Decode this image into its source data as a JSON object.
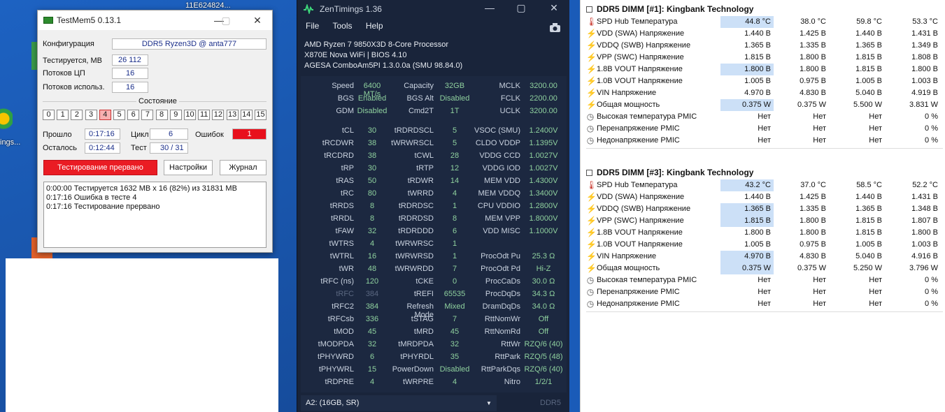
{
  "desktop": {
    "icon_label_top": "11E624824...",
    "icon_label_side": "ings..."
  },
  "testmem": {
    "title": "TestMem5  0.13.1",
    "config_label": "Конфигурация",
    "config_value": "DDR5 Ryzen3D @ anta777",
    "tested_label": "Тестируется, MB",
    "tested_value": "26 112",
    "threads_label": "Потоков ЦП",
    "threads_value": "16",
    "threads_used_label": "Потоков использ.",
    "threads_used_value": "16",
    "state_label": "Состояние",
    "states": [
      "0",
      "1",
      "2",
      "3",
      "4",
      "5",
      "6",
      "7",
      "8",
      "9",
      "10",
      "11",
      "12",
      "13",
      "14",
      "15"
    ],
    "elapsed_label": "Прошло",
    "elapsed_value": "0:17:16",
    "cycle_label": "Цикл",
    "cycle_value": "6",
    "errors_label": "Ошибок",
    "errors_value": "1",
    "remaining_label": "Осталось",
    "remaining_value": "0:12:44",
    "test_label": "Тест",
    "test_value": "30 / 31",
    "status_button": "Тестирование прервано",
    "settings_button": "Настройки",
    "log_button": "Журнал",
    "log_lines": [
      "0:00:00  Тестируется 1632 MB x 16 (82%) из 31831 MB",
      "0:17:16  Ошибка в тесте 4",
      "0:17:16  Тестирование прервано"
    ]
  },
  "zen": {
    "title": "ZenTimings 1.36",
    "menu": [
      "File",
      "Tools",
      "Help"
    ],
    "cpu": "AMD Ryzen 7 9850X3D 8-Core Processor",
    "board": "X870E Nova WiFi | BIOS 4.10",
    "agesa": "AGESA ComboAm5PI 1.3.0.0a (SMU 98.84.0)",
    "top": [
      [
        "Speed",
        "6400 MT/s",
        "Capacity",
        "32GB",
        "MCLK",
        "3200.00"
      ],
      [
        "BGS",
        "Enabled",
        "BGS Alt",
        "Disabled",
        "FCLK",
        "2200.00"
      ],
      [
        "GDM",
        "Disabled",
        "Cmd2T",
        "1T",
        "UCLK",
        "3200.00"
      ]
    ],
    "rows": [
      [
        "tCL",
        "30",
        "tRDRDSCL",
        "5",
        "VSOC (SMU)",
        "1.2400V"
      ],
      [
        "tRCDWR",
        "38",
        "tWRWRSCL",
        "5",
        "CLDO VDDP",
        "1.1395V"
      ],
      [
        "tRCDRD",
        "38",
        "tCWL",
        "28",
        "VDDG CCD",
        "1.0027V"
      ],
      [
        "tRP",
        "30",
        "tRTP",
        "12",
        "VDDG IOD",
        "1.0027V"
      ],
      [
        "tRAS",
        "50",
        "tRDWR",
        "14",
        "MEM VDD",
        "1.4300V"
      ],
      [
        "tRC",
        "80",
        "tWRRD",
        "4",
        "MEM VDDQ",
        "1.3400V"
      ],
      [
        "tRRDS",
        "8",
        "tRDRDSC",
        "1",
        "CPU VDDIO",
        "1.2800V"
      ],
      [
        "tRRDL",
        "8",
        "tRDRDSD",
        "8",
        "MEM VPP",
        "1.8000V"
      ],
      [
        "tFAW",
        "32",
        "tRDRDDD",
        "6",
        "VDD MISC",
        "1.1000V"
      ],
      [
        "tWTRS",
        "4",
        "tWRWRSC",
        "1",
        "",
        ""
      ],
      [
        "tWTRL",
        "16",
        "tWRWRSD",
        "1",
        "ProcOdt Pu",
        "25.3 Ω"
      ],
      [
        "tWR",
        "48",
        "tWRWRDD",
        "7",
        "ProcOdt Pd",
        "Hi-Z"
      ],
      [
        "tRFC (ns)",
        "120",
        "tCKE",
        "0",
        "ProcCaDs",
        "30.0 Ω"
      ],
      [
        "tRFC",
        "384",
        "tREFI",
        "65535",
        "ProcDqDs",
        "34.3 Ω"
      ],
      [
        "tRFC2",
        "384",
        "Refresh Mode",
        "Mixed",
        "DramDqDs",
        "34.0 Ω"
      ],
      [
        "tRFCsb",
        "336",
        "tSTAG",
        "7",
        "RttNomWr",
        "Off"
      ],
      [
        "tMOD",
        "45",
        "tMRD",
        "45",
        "RttNomRd",
        "Off"
      ],
      [
        "tMODPDA",
        "32",
        "tMRDPDA",
        "32",
        "RttWr",
        "RZQ/6 (40)"
      ],
      [
        "tPHYWRD",
        "6",
        "tPHYRDL",
        "35",
        "RttPark",
        "RZQ/5 (48)"
      ],
      [
        "tPHYWRL",
        "15",
        "PowerDown",
        "Disabled",
        "RttParkDqs",
        "RZQ/6 (40)"
      ],
      [
        "tRDPRE",
        "4",
        "tWRPRE",
        "4",
        "Nitro",
        "1/2/1"
      ]
    ],
    "slot": "A2:  (16GB, SR)",
    "mem_type": "DDR5"
  },
  "sensors": {
    "sections": [
      {
        "title": "DDR5 DIMM [#1]: Kingbank Technology",
        "rows": [
          {
            "icon": "thermometer-icon",
            "name": "SPD Hub Температура",
            "v": [
              "44.8 °C",
              "38.0 °C",
              "59.8 °C",
              "53.3 °C"
            ],
            "hl": true
          },
          {
            "icon": "lightning-icon",
            "name": "VDD (SWA) Напряжение",
            "v": [
              "1.440 В",
              "1.425 В",
              "1.440 В",
              "1.431 В"
            ],
            "hl": false
          },
          {
            "icon": "lightning-icon",
            "name": "VDDQ (SWB) Напряжение",
            "v": [
              "1.365 В",
              "1.335 В",
              "1.365 В",
              "1.349 В"
            ],
            "hl": false
          },
          {
            "icon": "lightning-icon",
            "name": "VPP (SWC) Напряжение",
            "v": [
              "1.815 В",
              "1.800 В",
              "1.815 В",
              "1.808 В"
            ],
            "hl": false
          },
          {
            "icon": "lightning-icon",
            "name": "1.8В VOUT Напряжение",
            "v": [
              "1.800 В",
              "1.800 В",
              "1.815 В",
              "1.800 В"
            ],
            "hl": true
          },
          {
            "icon": "lightning-icon",
            "name": "1.0В VOUT Напряжение",
            "v": [
              "1.005 В",
              "0.975 В",
              "1.005 В",
              "1.003 В"
            ],
            "hl": false
          },
          {
            "icon": "lightning-icon",
            "name": "VIN Напряжение",
            "v": [
              "4.970 В",
              "4.830 В",
              "5.040 В",
              "4.919 В"
            ],
            "hl": false
          },
          {
            "icon": "lightning-icon",
            "name": "Общая мощность",
            "v": [
              "0.375 W",
              "0.375 W",
              "5.500 W",
              "3.831 W"
            ],
            "hl": true
          },
          {
            "icon": "clock-icon",
            "name": "Высокая температура PMIC",
            "v": [
              "Нет",
              "Нет",
              "Нет",
              "0 %"
            ],
            "hl": false
          },
          {
            "icon": "clock-icon",
            "name": "Перенапряжение PMIC",
            "v": [
              "Нет",
              "Нет",
              "Нет",
              "0 %"
            ],
            "hl": false
          },
          {
            "icon": "clock-icon",
            "name": "Недонапряжение PMIC",
            "v": [
              "Нет",
              "Нет",
              "Нет",
              "0 %"
            ],
            "hl": false
          }
        ]
      },
      {
        "title": "DDR5 DIMM [#3]: Kingbank Technology",
        "rows": [
          {
            "icon": "thermometer-icon",
            "name": "SPD Hub Температура",
            "v": [
              "43.2 °C",
              "37.0 °C",
              "58.5 °C",
              "52.2 °C"
            ],
            "hl": true
          },
          {
            "icon": "lightning-icon",
            "name": "VDD (SWA) Напряжение",
            "v": [
              "1.440 В",
              "1.425 В",
              "1.440 В",
              "1.431 В"
            ],
            "hl": false
          },
          {
            "icon": "lightning-icon",
            "name": "VDDQ (SWB) Напряжение",
            "v": [
              "1.365 В",
              "1.335 В",
              "1.365 В",
              "1.348 В"
            ],
            "hl": true
          },
          {
            "icon": "lightning-icon",
            "name": "VPP (SWC) Напряжение",
            "v": [
              "1.815 В",
              "1.800 В",
              "1.815 В",
              "1.807 В"
            ],
            "hl": true
          },
          {
            "icon": "lightning-icon",
            "name": "1.8В VOUT Напряжение",
            "v": [
              "1.800 В",
              "1.800 В",
              "1.815 В",
              "1.800 В"
            ],
            "hl": false
          },
          {
            "icon": "lightning-icon",
            "name": "1.0В VOUT Напряжение",
            "v": [
              "1.005 В",
              "0.975 В",
              "1.005 В",
              "1.003 В"
            ],
            "hl": false
          },
          {
            "icon": "lightning-icon",
            "name": "VIN Напряжение",
            "v": [
              "4.970 В",
              "4.830 В",
              "5.040 В",
              "4.916 В"
            ],
            "hl": true
          },
          {
            "icon": "lightning-icon",
            "name": "Общая мощность",
            "v": [
              "0.375 W",
              "0.375 W",
              "5.250 W",
              "3.796 W"
            ],
            "hl": true
          },
          {
            "icon": "clock-icon",
            "name": "Высокая температура PMIC",
            "v": [
              "Нет",
              "Нет",
              "Нет",
              "0 %"
            ],
            "hl": false
          },
          {
            "icon": "clock-icon",
            "name": "Перенапряжение PMIC",
            "v": [
              "Нет",
              "Нет",
              "Нет",
              "0 %"
            ],
            "hl": false
          },
          {
            "icon": "clock-icon",
            "name": "Недонапряжение PMIC",
            "v": [
              "Нет",
              "Нет",
              "Нет",
              "0 %"
            ],
            "hl": false
          }
        ]
      }
    ],
    "colors": {
      "highlight": "#cce0f7",
      "thermometer": "#c8352b",
      "lightning": "#e0a100",
      "clock": "#555555"
    }
  }
}
